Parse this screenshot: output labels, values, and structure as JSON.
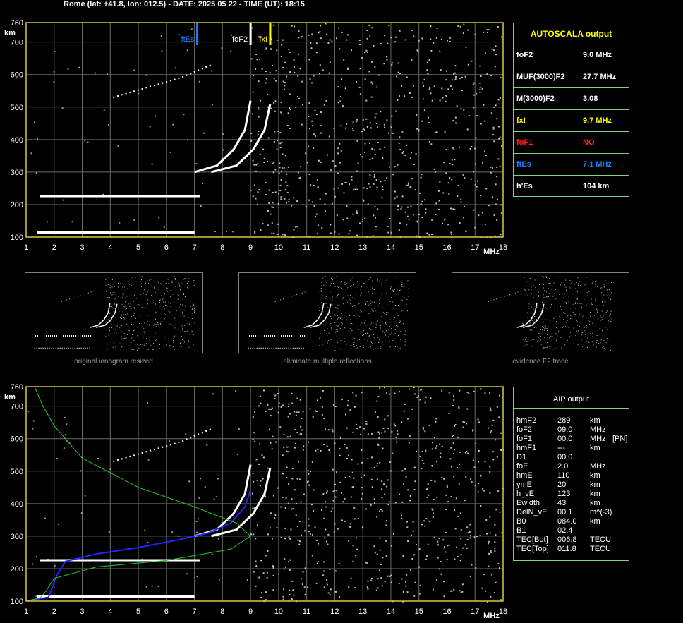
{
  "header": "Rome (lat: +41.8, lon: 012.5) - DATE: 2025 05 22 - TIME (UT): 18:15",
  "colors": {
    "frame": "#d8c93a",
    "grid": "#6a6a6a",
    "trace": "#ffffff",
    "ftEs": "#1f7fff",
    "foF2": "#ffffff",
    "fxI": "#ffff00",
    "foF1": "#ff2020",
    "aip_profile": "#2424ff",
    "green_curve": "#22cc22",
    "panel_border": "#7fd17f"
  },
  "chart_data": [
    {
      "type": "scatter",
      "name": "ionogram",
      "xlabel": "MHz",
      "ylabel": "km",
      "xlim": [
        1,
        18
      ],
      "ylim": [
        100,
        760
      ],
      "x_ticks": [
        "1",
        "2",
        "3",
        "4",
        "5",
        "6",
        "7",
        "8",
        "9",
        "10",
        "11",
        "12",
        "13",
        "14",
        "15",
        "16",
        "17",
        "18"
      ],
      "y_ticks": [
        "100",
        "200",
        "300",
        "400",
        "500",
        "600",
        "700",
        "760"
      ],
      "grid": true,
      "markers": [
        {
          "label": "ftEs",
          "x": 7.1,
          "color": "#1f7fff"
        },
        {
          "label": "foF2",
          "x": 9.0,
          "color": "#ffffff"
        },
        {
          "label": "fxI",
          "x": 9.7,
          "color": "#ffff00"
        }
      ],
      "traces": [
        {
          "name": "Es",
          "x_start": 1.4,
          "x_end": 7.0,
          "y": 114
        },
        {
          "name": "Es-2",
          "x_start": 1.5,
          "x_end": 7.2,
          "y": 226
        },
        {
          "name": "F2-o",
          "points": [
            [
              7.0,
              300
            ],
            [
              7.8,
              320
            ],
            [
              8.4,
              370
            ],
            [
              8.8,
              430
            ],
            [
              9.0,
              520
            ]
          ]
        },
        {
          "name": "F2-x",
          "points": [
            [
              7.6,
              300
            ],
            [
              8.5,
              320
            ],
            [
              9.1,
              370
            ],
            [
              9.5,
              430
            ],
            [
              9.7,
              510
            ]
          ]
        },
        {
          "name": "F2-multiple",
          "points": [
            [
              4.1,
              530
            ],
            [
              5.5,
              565
            ],
            [
              6.5,
              590
            ],
            [
              7.6,
              630
            ]
          ]
        }
      ]
    },
    {
      "type": "line",
      "name": "aip-profile",
      "xlim": [
        1,
        18
      ],
      "ylim": [
        100,
        760
      ],
      "x_ticks": [
        "1",
        "2",
        "3",
        "4",
        "5",
        "6",
        "7",
        "8",
        "9",
        "10",
        "11",
        "12",
        "13",
        "14",
        "15",
        "16",
        "17",
        "18"
      ],
      "y_ticks": [
        "100",
        "200",
        "300",
        "400",
        "500",
        "600",
        "700",
        "760"
      ],
      "series": [
        {
          "color": "#2424ff",
          "points": [
            [
              1.0,
              100
            ],
            [
              1.8,
              112
            ],
            [
              2.1,
              180
            ],
            [
              2.4,
              222
            ],
            [
              3.5,
              245
            ],
            [
              5.0,
              265
            ],
            [
              6.5,
              290
            ],
            [
              7.5,
              310
            ],
            [
              8.3,
              340
            ],
            [
              8.8,
              390
            ],
            [
              9.0,
              440
            ]
          ]
        },
        {
          "color": "#22cc22",
          "points": [
            [
              1.3,
              760
            ],
            [
              1.6,
              700
            ],
            [
              2.0,
              640
            ],
            [
              3.0,
              540
            ],
            [
              5.0,
              450
            ],
            [
              7.0,
              390
            ],
            [
              8.5,
              340
            ],
            [
              9.0,
              300
            ],
            [
              8.3,
              260
            ],
            [
              6.0,
              225
            ],
            [
              3.5,
              205
            ],
            [
              2.0,
              170
            ],
            [
              1.7,
              130
            ],
            [
              1.5,
              110
            ],
            [
              1.0,
              100
            ]
          ]
        }
      ]
    }
  ],
  "autoscala": {
    "title": "AUTOSCALA output",
    "rows": [
      {
        "key": "foF2",
        "value": "9.0 MHz",
        "color": "#ffffff"
      },
      {
        "key": "MUF(3000)F2",
        "value": "27.7 MHz",
        "color": "#ffffff"
      },
      {
        "key": "M(3000)F2",
        "value": "3.08",
        "color": "#ffffff"
      },
      {
        "key": "fxI",
        "value": "9.7 MHz",
        "color": "#ffff00"
      },
      {
        "key": "foF1",
        "value": "NO",
        "color": "#ff2020"
      },
      {
        "key": "ftEs",
        "value": "7.1 MHz",
        "color": "#1f7fff"
      },
      {
        "key": "h'Es",
        "value": "104     km",
        "color": "#ffffff"
      }
    ]
  },
  "thumbnails": [
    {
      "caption": "original ionogram resized"
    },
    {
      "caption": "eliminate multiple reflections"
    },
    {
      "caption": "evidence F2 trace"
    }
  ],
  "aip": {
    "title": "AIP output",
    "rows": [
      {
        "k": "hmF2",
        "v": "289",
        "u": "km",
        "x": ""
      },
      {
        "k": "foF2",
        "v": "09.0",
        "u": "MHz",
        "x": ""
      },
      {
        "k": "foF1",
        "v": "00.0",
        "u": "MHz",
        "x": "[PN]"
      },
      {
        "k": "hmF1",
        "v": "---",
        "u": "km",
        "x": ""
      },
      {
        "k": "D1",
        "v": "00.0",
        "u": "",
        "x": ""
      },
      {
        "k": "foE",
        "v": "2.0",
        "u": "MHz",
        "x": ""
      },
      {
        "k": "hmE",
        "v": "110",
        "u": "km",
        "x": ""
      },
      {
        "k": "ymE",
        "v": "20",
        "u": "km",
        "x": ""
      },
      {
        "k": "h_vE",
        "v": "123",
        "u": "km",
        "x": ""
      },
      {
        "k": "Ewidth",
        "v": "43",
        "u": "km",
        "x": ""
      },
      {
        "k": "DelN_vE",
        "v": "00.1",
        "u": "m^(-3)",
        "x": ""
      },
      {
        "k": "B0",
        "v": "084.0",
        "u": "km",
        "x": ""
      },
      {
        "k": "B1",
        "v": "02.4",
        "u": "",
        "x": ""
      },
      {
        "k": "TEC[Bot]",
        "v": "006.8",
        "u": "TECU",
        "x": ""
      },
      {
        "k": "TEC[Top]",
        "v": "011.8",
        "u": "TECU",
        "x": ""
      }
    ]
  }
}
